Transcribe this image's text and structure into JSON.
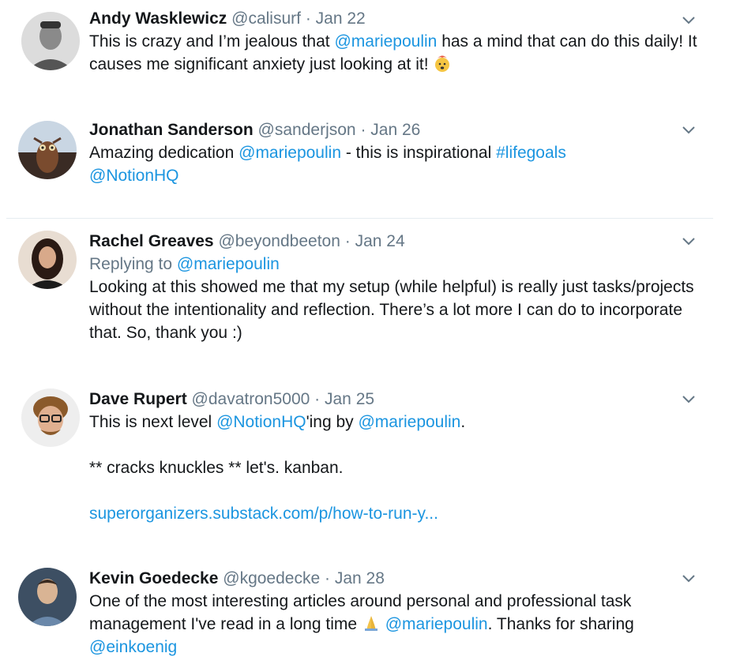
{
  "tweets": [
    {
      "name": "Andy Wasklewicz",
      "handle": "@calisurf",
      "sep": "·",
      "date": "Jan 22",
      "t1": "This is crazy and I’m jealous that ",
      "m1": "@mariepoulin",
      "t2": " has a mind that can do this daily! It causes me significant anxiety just looking at it! ",
      "emoji": "exploding-head-emoji"
    },
    {
      "name": "Jonathan Sanderson",
      "handle": "@sanderjson",
      "sep": "·",
      "date": "Jan 26",
      "t1": "Amazing dedication ",
      "m1": "@mariepoulin",
      "t2": " - this is inspirational ",
      "m2": "#lifegoals",
      "m3": "@NotionHQ"
    },
    {
      "name": "Rachel Greaves",
      "handle": "@beyondbeeton",
      "sep": "·",
      "date": "Jan 24",
      "reply_prefix": "Replying to ",
      "reply_to": "@mariepoulin",
      "t1": "Looking at this showed me that my setup (while helpful) is really just tasks/projects without the intentionality and reflection. There’s a lot more I can do to incorporate that. So, thank you :)"
    },
    {
      "name": "Dave Rupert",
      "handle": "@davatron5000",
      "sep": "·",
      "date": "Jan 25",
      "t1": "This is next level ",
      "m1": "@NotionHQ",
      "t2": "'ing by ",
      "m2": "@mariepoulin",
      "t3": ".",
      "line2": "** cracks knuckles ** let's. kanban.",
      "url": "superorganizers.substack.com/p/how-to-run-y..."
    },
    {
      "name": "Kevin Goedecke",
      "handle": "@kgoedecke",
      "sep": "·",
      "date": "Jan 28",
      "t1": "One of the most interesting articles around personal and professional task management I've read in a long time ",
      "emoji": "folded-hands-emoji",
      "t2": " ",
      "m1": "@mariepoulin",
      "t3": ". Thanks for sharing ",
      "m2": "@einkoenig"
    }
  ],
  "colors": {
    "text": "#14171a",
    "meta": "#657786",
    "link": "#1b95e0",
    "divider": "#e6ecf0"
  }
}
